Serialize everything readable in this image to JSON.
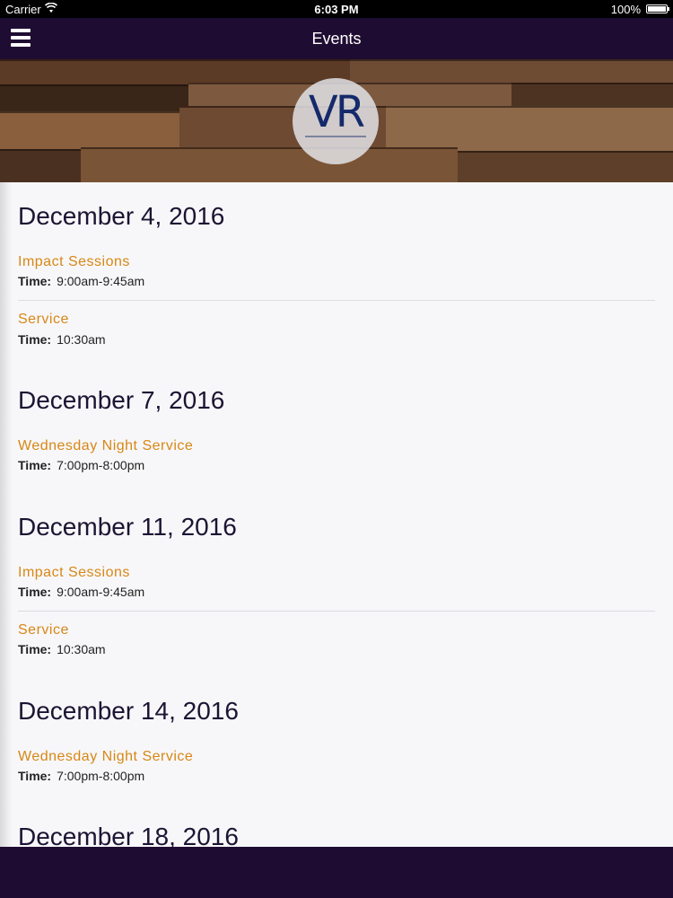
{
  "status_bar": {
    "carrier": "Carrier",
    "time": "6:03 PM",
    "battery": "100%"
  },
  "nav": {
    "title": "Events"
  },
  "hero": {
    "logo_text": "VR"
  },
  "events": {
    "d1": "December 4, 2016",
    "d1_e1_title": "Impact Sessions",
    "d1_e1_time": "9:00am-9:45am",
    "d1_e2_title": "Service",
    "d1_e2_time": "10:30am",
    "d2": "December 7, 2016",
    "d2_e1_title": "Wednesday Night Service",
    "d2_e1_time": "7:00pm-8:00pm",
    "d3": "December 11, 2016",
    "d3_e1_title": "Impact Sessions",
    "d3_e1_time": "9:00am-9:45am",
    "d3_e2_title": "Service",
    "d3_e2_time": "10:30am",
    "d4": "December 14, 2016",
    "d4_e1_title": "Wednesday Night Service",
    "d4_e1_time": "7:00pm-8:00pm",
    "d5": "December 18, 2016",
    "time_label": "Time:"
  },
  "colors": {
    "nav_bg": "#1f0c32",
    "event_title": "#d88716",
    "date_heading": "#1c1433"
  }
}
